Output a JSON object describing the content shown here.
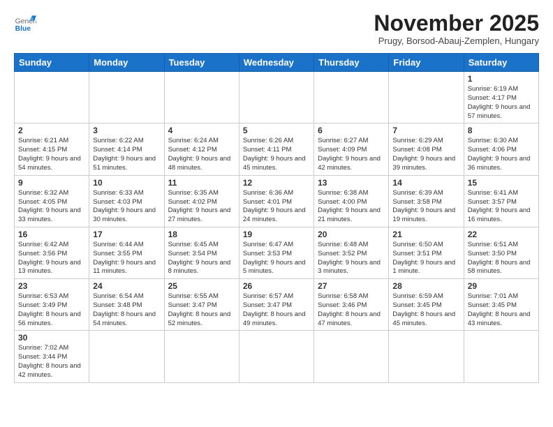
{
  "header": {
    "logo_general": "General",
    "logo_blue": "Blue",
    "month_title": "November 2025",
    "location": "Prugy, Borsod-Abauj-Zemplen, Hungary"
  },
  "days_of_week": [
    "Sunday",
    "Monday",
    "Tuesday",
    "Wednesday",
    "Thursday",
    "Friday",
    "Saturday"
  ],
  "weeks": [
    [
      {
        "num": "",
        "info": ""
      },
      {
        "num": "",
        "info": ""
      },
      {
        "num": "",
        "info": ""
      },
      {
        "num": "",
        "info": ""
      },
      {
        "num": "",
        "info": ""
      },
      {
        "num": "",
        "info": ""
      },
      {
        "num": "1",
        "info": "Sunrise: 6:19 AM\nSunset: 4:17 PM\nDaylight: 9 hours\nand 57 minutes."
      }
    ],
    [
      {
        "num": "2",
        "info": "Sunrise: 6:21 AM\nSunset: 4:15 PM\nDaylight: 9 hours\nand 54 minutes."
      },
      {
        "num": "3",
        "info": "Sunrise: 6:22 AM\nSunset: 4:14 PM\nDaylight: 9 hours\nand 51 minutes."
      },
      {
        "num": "4",
        "info": "Sunrise: 6:24 AM\nSunset: 4:12 PM\nDaylight: 9 hours\nand 48 minutes."
      },
      {
        "num": "5",
        "info": "Sunrise: 6:26 AM\nSunset: 4:11 PM\nDaylight: 9 hours\nand 45 minutes."
      },
      {
        "num": "6",
        "info": "Sunrise: 6:27 AM\nSunset: 4:09 PM\nDaylight: 9 hours\nand 42 minutes."
      },
      {
        "num": "7",
        "info": "Sunrise: 6:29 AM\nSunset: 4:08 PM\nDaylight: 9 hours\nand 39 minutes."
      },
      {
        "num": "8",
        "info": "Sunrise: 6:30 AM\nSunset: 4:06 PM\nDaylight: 9 hours\nand 36 minutes."
      }
    ],
    [
      {
        "num": "9",
        "info": "Sunrise: 6:32 AM\nSunset: 4:05 PM\nDaylight: 9 hours\nand 33 minutes."
      },
      {
        "num": "10",
        "info": "Sunrise: 6:33 AM\nSunset: 4:03 PM\nDaylight: 9 hours\nand 30 minutes."
      },
      {
        "num": "11",
        "info": "Sunrise: 6:35 AM\nSunset: 4:02 PM\nDaylight: 9 hours\nand 27 minutes."
      },
      {
        "num": "12",
        "info": "Sunrise: 6:36 AM\nSunset: 4:01 PM\nDaylight: 9 hours\nand 24 minutes."
      },
      {
        "num": "13",
        "info": "Sunrise: 6:38 AM\nSunset: 4:00 PM\nDaylight: 9 hours\nand 21 minutes."
      },
      {
        "num": "14",
        "info": "Sunrise: 6:39 AM\nSunset: 3:58 PM\nDaylight: 9 hours\nand 19 minutes."
      },
      {
        "num": "15",
        "info": "Sunrise: 6:41 AM\nSunset: 3:57 PM\nDaylight: 9 hours\nand 16 minutes."
      }
    ],
    [
      {
        "num": "16",
        "info": "Sunrise: 6:42 AM\nSunset: 3:56 PM\nDaylight: 9 hours\nand 13 minutes."
      },
      {
        "num": "17",
        "info": "Sunrise: 6:44 AM\nSunset: 3:55 PM\nDaylight: 9 hours\nand 11 minutes."
      },
      {
        "num": "18",
        "info": "Sunrise: 6:45 AM\nSunset: 3:54 PM\nDaylight: 9 hours\nand 8 minutes."
      },
      {
        "num": "19",
        "info": "Sunrise: 6:47 AM\nSunset: 3:53 PM\nDaylight: 9 hours\nand 5 minutes."
      },
      {
        "num": "20",
        "info": "Sunrise: 6:48 AM\nSunset: 3:52 PM\nDaylight: 9 hours\nand 3 minutes."
      },
      {
        "num": "21",
        "info": "Sunrise: 6:50 AM\nSunset: 3:51 PM\nDaylight: 9 hours\nand 1 minute."
      },
      {
        "num": "22",
        "info": "Sunrise: 6:51 AM\nSunset: 3:50 PM\nDaylight: 8 hours\nand 58 minutes."
      }
    ],
    [
      {
        "num": "23",
        "info": "Sunrise: 6:53 AM\nSunset: 3:49 PM\nDaylight: 8 hours\nand 56 minutes."
      },
      {
        "num": "24",
        "info": "Sunrise: 6:54 AM\nSunset: 3:48 PM\nDaylight: 8 hours\nand 54 minutes."
      },
      {
        "num": "25",
        "info": "Sunrise: 6:55 AM\nSunset: 3:47 PM\nDaylight: 8 hours\nand 52 minutes."
      },
      {
        "num": "26",
        "info": "Sunrise: 6:57 AM\nSunset: 3:47 PM\nDaylight: 8 hours\nand 49 minutes."
      },
      {
        "num": "27",
        "info": "Sunrise: 6:58 AM\nSunset: 3:46 PM\nDaylight: 8 hours\nand 47 minutes."
      },
      {
        "num": "28",
        "info": "Sunrise: 6:59 AM\nSunset: 3:45 PM\nDaylight: 8 hours\nand 45 minutes."
      },
      {
        "num": "29",
        "info": "Sunrise: 7:01 AM\nSunset: 3:45 PM\nDaylight: 8 hours\nand 43 minutes."
      }
    ],
    [
      {
        "num": "30",
        "info": "Sunrise: 7:02 AM\nSunset: 3:44 PM\nDaylight: 8 hours\nand 42 minutes."
      },
      {
        "num": "",
        "info": ""
      },
      {
        "num": "",
        "info": ""
      },
      {
        "num": "",
        "info": ""
      },
      {
        "num": "",
        "info": ""
      },
      {
        "num": "",
        "info": ""
      },
      {
        "num": "",
        "info": ""
      }
    ]
  ]
}
